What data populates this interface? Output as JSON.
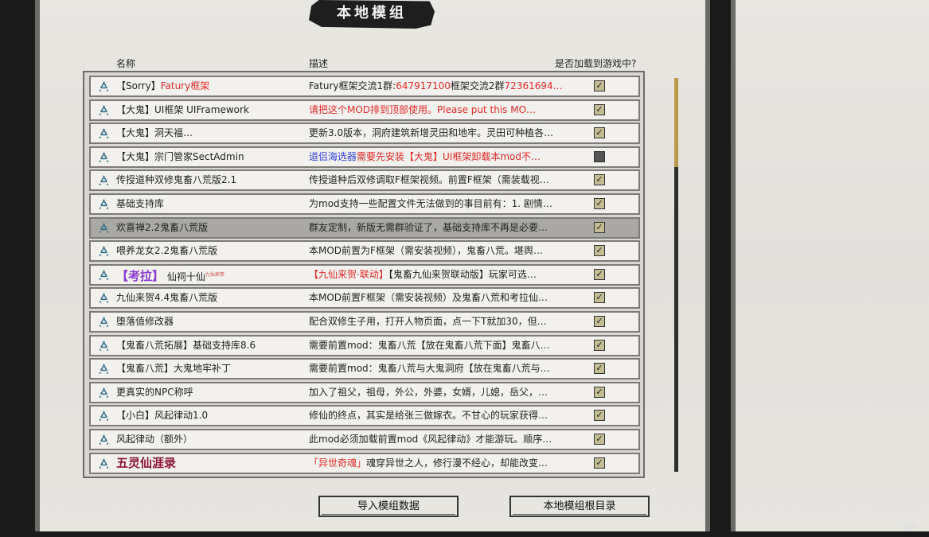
{
  "title": "本地模组",
  "headers": {
    "name": "名称",
    "desc": "描述",
    "load": "是否加载到游戏中?"
  },
  "mods": [
    {
      "name_parts": [
        {
          "t": "【Sorry】"
        },
        {
          "t": "Fatury框架",
          "c": "red"
        }
      ],
      "desc_parts": [
        {
          "t": "Fatury框架交流1群:"
        },
        {
          "t": "647917100",
          "c": "red"
        },
        {
          "t": "框架交流2群"
        },
        {
          "t": "72361694…",
          "c": "red"
        }
      ],
      "checked": true
    },
    {
      "name_parts": [
        {
          "t": "【大鬼】UI框架 UIFramework"
        }
      ],
      "desc_parts": [
        {
          "t": "请把这个MOD排到顶部使用。Please put this MO…",
          "c": "red"
        }
      ],
      "checked": true
    },
    {
      "name_parts": [
        {
          "t": "【大鬼】洞天福…"
        }
      ],
      "desc_parts": [
        {
          "t": "更新3.0版本，洞府建筑新增灵田和地牢。灵田可种植各…"
        }
      ],
      "checked": true
    },
    {
      "name_parts": [
        {
          "t": "【大鬼】宗门管家SectAdmin"
        }
      ],
      "desc_parts": [
        {
          "t": "道侣海选器",
          "c": "blue"
        },
        {
          "t": "需要先安装【大鬼】UI框架卸载本mod不…",
          "c": "red"
        }
      ],
      "checked": false
    },
    {
      "name_parts": [
        {
          "t": "传授道种双修鬼畜八荒版2.1"
        }
      ],
      "desc_parts": [
        {
          "t": "传授道种后双修调取F框架视频。前置F框架（需装载视…"
        }
      ],
      "checked": true
    },
    {
      "name_parts": [
        {
          "t": "基础支持库"
        }
      ],
      "desc_parts": [
        {
          "t": "为mod支持一些配置文件无法做到的事目前有：1. 剧情…"
        }
      ],
      "checked": true
    },
    {
      "name_parts": [
        {
          "t": "欢喜禅2.2鬼畜八荒版"
        }
      ],
      "desc_parts": [
        {
          "t": "群友定制，新版无需群验证了，基础支持库不再是必要…"
        }
      ],
      "checked": true,
      "selected": true
    },
    {
      "name_parts": [
        {
          "t": "喂养龙女2.2鬼畜八荒版"
        }
      ],
      "desc_parts": [
        {
          "t": "本MOD前置为F框架（需安装视频），鬼畜八荒。堪舆…"
        }
      ],
      "checked": true
    },
    {
      "name_parts": [
        {
          "t": "【考拉】",
          "c": "purple big"
        },
        {
          "t": " 仙祠十仙"
        },
        {
          "t": "九仙来贺",
          "sup": true
        }
      ],
      "desc_parts": [
        {
          "t": "【九仙来贺·联动】",
          "c": "red"
        },
        {
          "t": "【鬼畜九仙来贺联动版】玩家可选…"
        }
      ],
      "checked": true
    },
    {
      "name_parts": [
        {
          "t": "九仙来贺4.4鬼畜八荒版"
        }
      ],
      "desc_parts": [
        {
          "t": "本MOD前置F框架（需安装视频）及鬼畜八荒和考拉仙…"
        }
      ],
      "checked": true
    },
    {
      "name_parts": [
        {
          "t": "堕落值修改器"
        }
      ],
      "desc_parts": [
        {
          "t": "配合双修生子用，打开人物页面，点一下T就加30，但…"
        }
      ],
      "checked": true
    },
    {
      "name_parts": [
        {
          "t": "【鬼畜八荒拓展】基础支持库8.6"
        }
      ],
      "desc_parts": [
        {
          "t": "需要前置mod：鬼畜八荒【放在鬼畜八荒下面】鬼畜八…"
        }
      ],
      "checked": true
    },
    {
      "name_parts": [
        {
          "t": "【鬼畜八荒】大鬼地牢补丁"
        }
      ],
      "desc_parts": [
        {
          "t": "需要前置mod：鬼畜八荒与大鬼洞府【放在鬼畜八荒与…"
        }
      ],
      "checked": true
    },
    {
      "name_parts": [
        {
          "t": "更真实的NPC称呼"
        }
      ],
      "desc_parts": [
        {
          "t": "加入了祖父，祖母，外公，外婆，女婿，儿媳，岳父，…"
        }
      ],
      "checked": true
    },
    {
      "name_parts": [
        {
          "t": "【小白】风起律动1.0"
        }
      ],
      "desc_parts": [
        {
          "t": "修仙的终点，其实是给张三做嫁衣。不甘心的玩家获得…"
        }
      ],
      "checked": true
    },
    {
      "name_parts": [
        {
          "t": "风起律动（额外）"
        }
      ],
      "desc_parts": [
        {
          "t": "此mod必须加载前置mod《风起律动》才能游玩。顺序…"
        }
      ],
      "checked": true
    },
    {
      "name_parts": [
        {
          "t": "五灵仙涯录",
          "c": "wine"
        }
      ],
      "desc_parts": [
        {
          "t": "「异世奇魂」",
          "c": "red"
        },
        {
          "t": "魂穿异世之人，修行漫不经心，却能改变…"
        }
      ],
      "checked": true
    }
  ],
  "buttons": {
    "import": "导入模组数据",
    "root": "本地模组根目录"
  },
  "watermark": "方舟",
  "colors": {
    "red": "#e02a2a",
    "blue": "#3344dd",
    "purple": "#8a3ad0",
    "wine": "#8b1538",
    "check_fill": "#c3bd93"
  },
  "icons": {
    "row": "recycle-icon",
    "check": "checkmark-icon"
  }
}
